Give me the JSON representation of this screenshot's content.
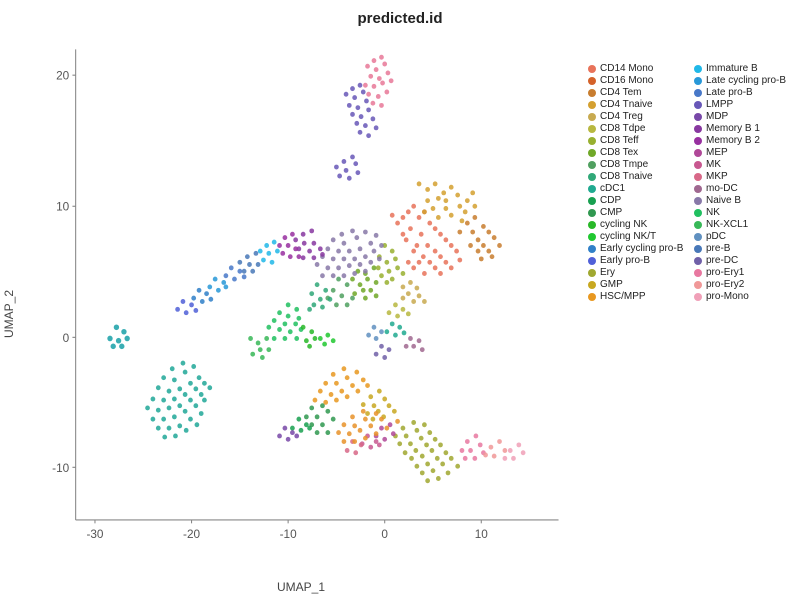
{
  "title": "predicted.id",
  "x_label": "UMAP_1",
  "y_label": "UMAP_2",
  "legend_col1": [
    {
      "label": "CD14 Mono",
      "color": "#E8735A"
    },
    {
      "label": "CD16 Mono",
      "color": "#D4622A"
    },
    {
      "label": "CD4 Tem",
      "color": "#C87D2F"
    },
    {
      "label": "CD4 Tnaive",
      "color": "#D4A030"
    },
    {
      "label": "CD4 Treg",
      "color": "#C8AA50"
    },
    {
      "label": "CD8 Tdpe",
      "color": "#B8B840"
    },
    {
      "label": "CD8 Teff",
      "color": "#98B030"
    },
    {
      "label": "CD8 Tex",
      "color": "#70A828"
    },
    {
      "label": "CD8 Tmpe",
      "color": "#50A060"
    },
    {
      "label": "CD8 Tnaive",
      "color": "#30A878"
    },
    {
      "label": "cDC1",
      "color": "#20AA90"
    },
    {
      "label": "CDP",
      "color": "#18A050"
    },
    {
      "label": "CMP",
      "color": "#309850"
    },
    {
      "label": "cycling NK",
      "color": "#28B828"
    },
    {
      "label": "cycling NK/T",
      "color": "#20C830"
    },
    {
      "label": "Early cycling pro-B",
      "color": "#3080C8"
    },
    {
      "label": "Early pro-B",
      "color": "#5060D8"
    },
    {
      "label": "Ery",
      "color": "#A0A830"
    },
    {
      "label": "GMP",
      "color": "#C8A820"
    },
    {
      "label": "HSC/MPP",
      "color": "#E89820"
    }
  ],
  "legend_col2": [
    {
      "label": "Immature B",
      "color": "#20B8E8"
    },
    {
      "label": "Late cycling pro-B",
      "color": "#2898D8"
    },
    {
      "label": "Late pro-B",
      "color": "#4878C8"
    },
    {
      "label": "LMPP",
      "color": "#6858B8"
    },
    {
      "label": "MDP",
      "color": "#7848A8"
    },
    {
      "label": "Memory B 1",
      "color": "#8838A0"
    },
    {
      "label": "Memory B 2",
      "color": "#9830A0"
    },
    {
      "label": "MEP",
      "color": "#B04898"
    },
    {
      "label": "MK",
      "color": "#C85890"
    },
    {
      "label": "MKP",
      "color": "#D86888"
    },
    {
      "label": "mo-DC",
      "color": "#A06890"
    },
    {
      "label": "Naive B",
      "color": "#8878A8"
    },
    {
      "label": "NK",
      "color": "#20C060"
    },
    {
      "label": "NK-XCL1",
      "color": "#38B858"
    },
    {
      "label": "pDC",
      "color": "#6090C0"
    },
    {
      "label": "pre-B",
      "color": "#4878B8"
    },
    {
      "label": "pre-DC",
      "color": "#7060A8"
    },
    {
      "label": "pro-Ery1",
      "color": "#E878A0"
    },
    {
      "label": "pro-Ery2",
      "color": "#F09898"
    },
    {
      "label": "pro-Mono",
      "color": "#F0A0B8"
    }
  ],
  "x_ticks": [
    "-30",
    "-20",
    "-10",
    "0",
    "10"
  ],
  "y_ticks": [
    "20",
    "10",
    "0",
    "-10"
  ]
}
